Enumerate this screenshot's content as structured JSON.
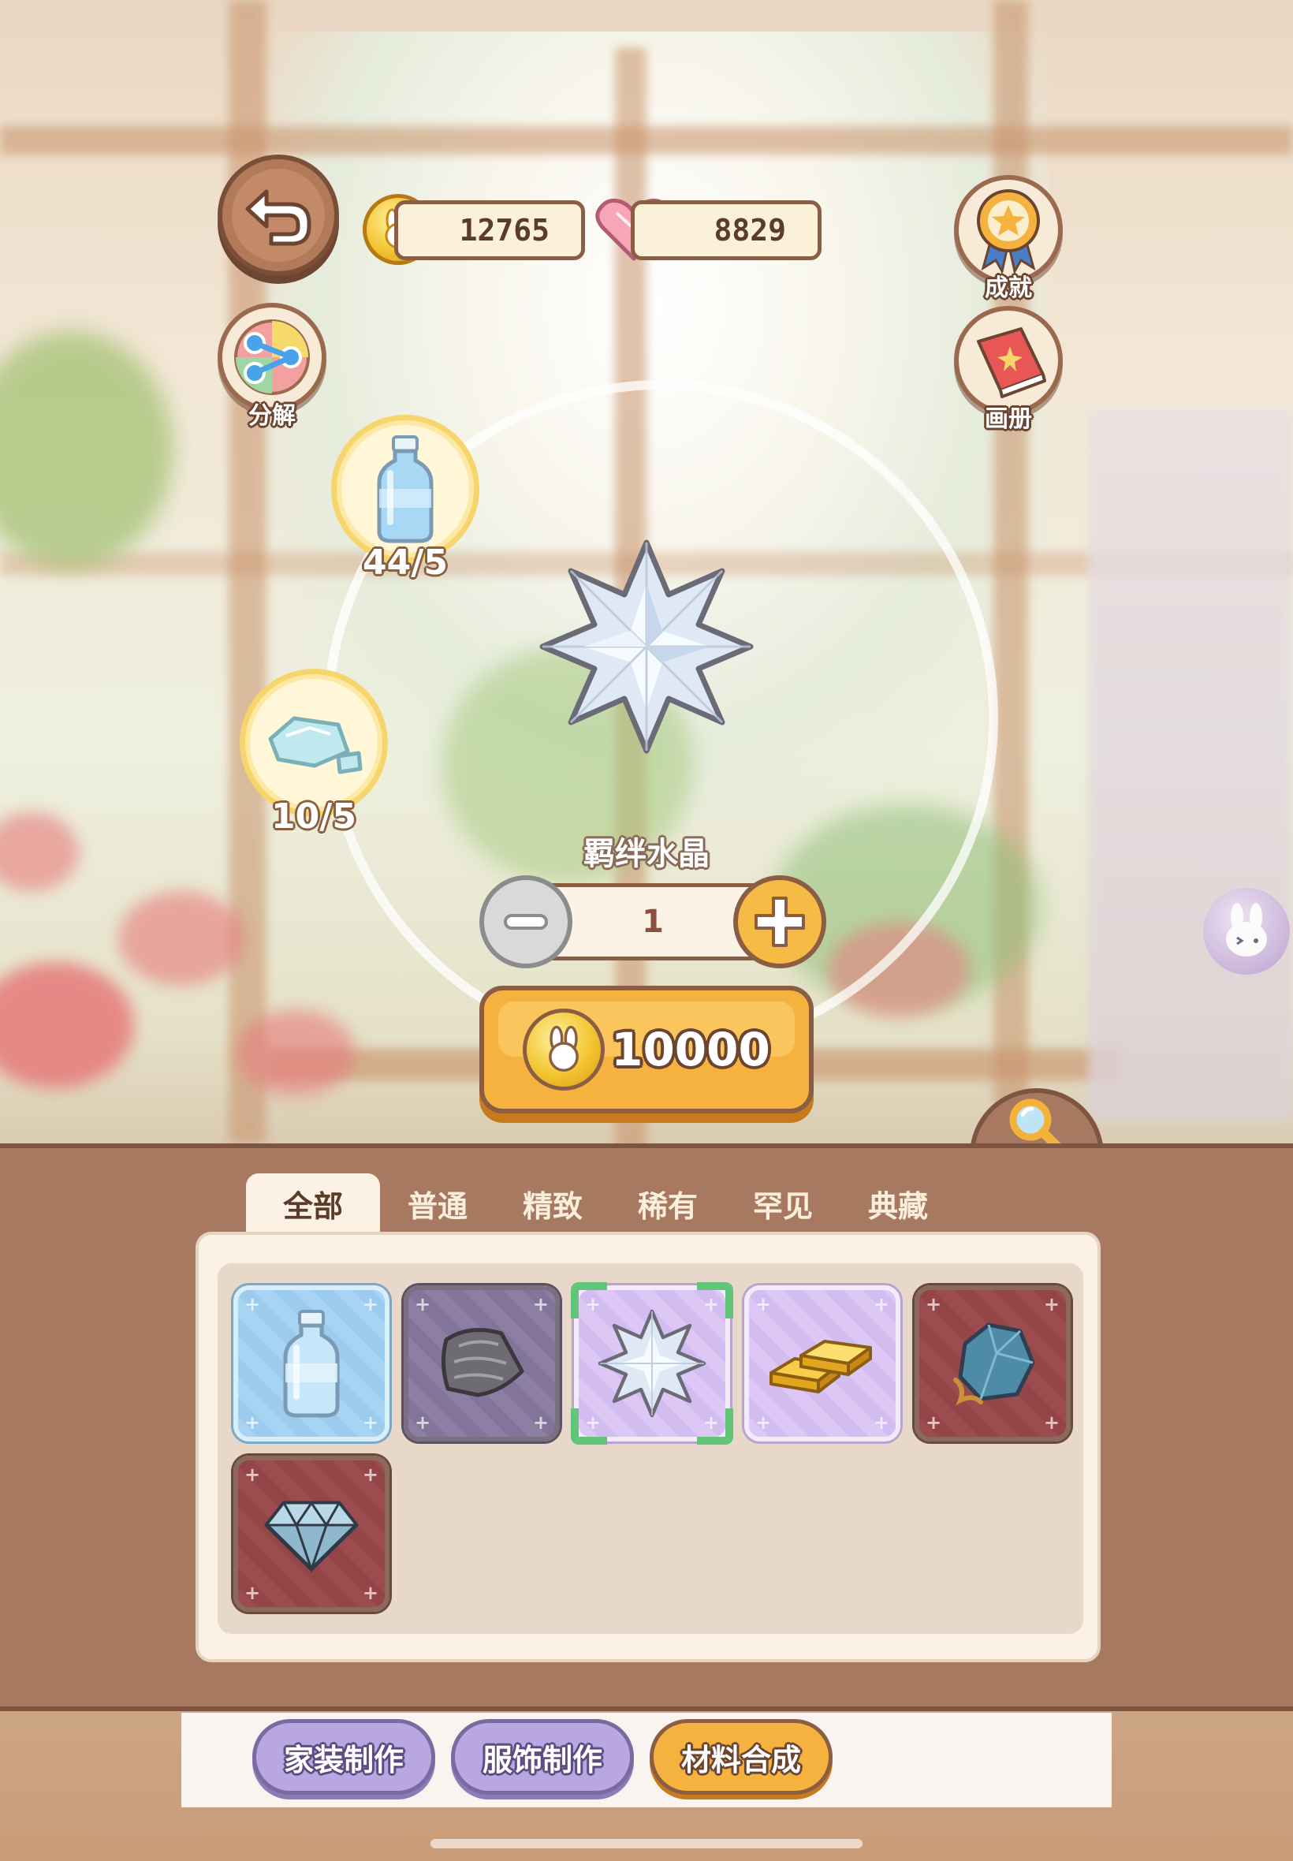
{
  "hud": {
    "coins": "12765",
    "hearts": "8829"
  },
  "side_buttons": {
    "decompose": "分解",
    "achievement": "成就",
    "album": "画册"
  },
  "synthesis": {
    "materials": [
      {
        "icon": "water-bottle-icon",
        "count": "44/5"
      },
      {
        "icon": "ice-shard-icon",
        "count": "10/5"
      }
    ],
    "product_icon": "crystal-star-icon",
    "product_name": "羁绊水晶",
    "quantity": "1",
    "cost": "10000"
  },
  "tabs": [
    "全部",
    "普通",
    "精致",
    "稀有",
    "罕见",
    "典藏"
  ],
  "active_tab": "全部",
  "items": [
    {
      "icon": "water-bottle-icon",
      "rarity": "blue"
    },
    {
      "icon": "cloth-icon",
      "rarity": "gray"
    },
    {
      "icon": "crystal-star-icon",
      "rarity": "purple",
      "selected": true
    },
    {
      "icon": "gold-bars-icon",
      "rarity": "purple"
    },
    {
      "icon": "ore-rock-icon",
      "rarity": "red"
    },
    {
      "icon": "diamond-icon",
      "rarity": "red"
    }
  ],
  "bottom_nav": [
    "家装制作",
    "服饰制作",
    "材料合成"
  ],
  "bottom_nav_active": "材料合成",
  "colors": {
    "panel": "#a67960",
    "accent_orange": "#f6b23e",
    "nav_purple": "#b8a7e0",
    "selected_green": "#62c67a"
  }
}
